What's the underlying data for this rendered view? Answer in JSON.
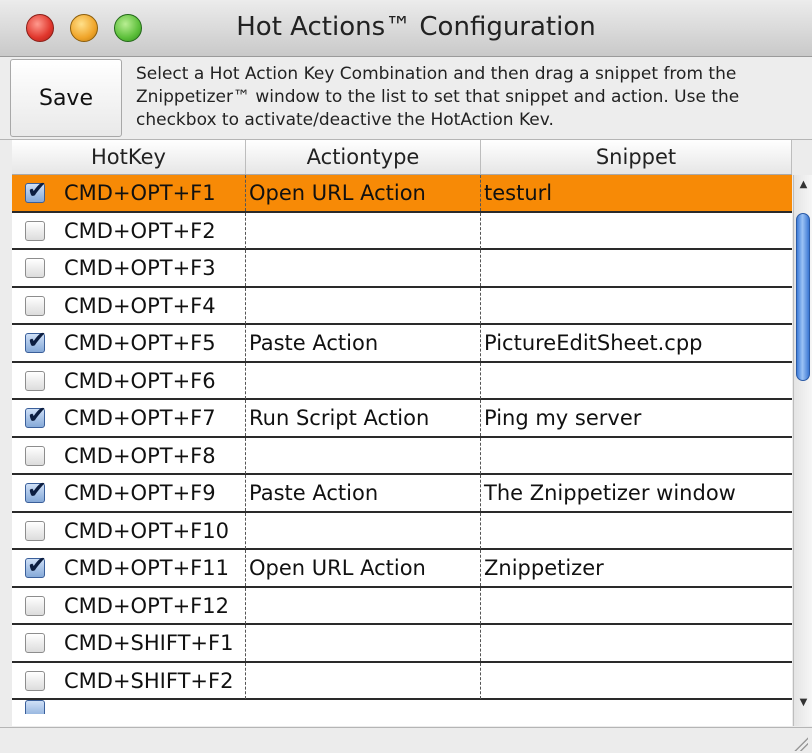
{
  "window": {
    "title": "Hot Actions™ Configuration"
  },
  "toolbar": {
    "save_label": "Save",
    "help_text": "Select a Hot Action Key Combination and then drag a snippet from the Znippetizer™ window to the list to set that snippet and action. Use the checkbox to activate/deactive the HotAction Kev."
  },
  "table": {
    "columns": [
      "HotKey",
      "Actiontype",
      "Snippet"
    ],
    "rows": [
      {
        "checked": true,
        "hotkey": "CMD+OPT+F1",
        "action": "Open URL Action",
        "snippet": "testurl",
        "selected": true
      },
      {
        "checked": false,
        "hotkey": "CMD+OPT+F2",
        "action": "",
        "snippet": ""
      },
      {
        "checked": false,
        "hotkey": "CMD+OPT+F3",
        "action": "",
        "snippet": ""
      },
      {
        "checked": false,
        "hotkey": "CMD+OPT+F4",
        "action": "",
        "snippet": ""
      },
      {
        "checked": true,
        "hotkey": "CMD+OPT+F5",
        "action": "Paste Action",
        "snippet": "PictureEditSheet.cpp"
      },
      {
        "checked": false,
        "hotkey": "CMD+OPT+F6",
        "action": "",
        "snippet": ""
      },
      {
        "checked": true,
        "hotkey": "CMD+OPT+F7",
        "action": "Run Script Action",
        "snippet": "Ping my server"
      },
      {
        "checked": false,
        "hotkey": "CMD+OPT+F8",
        "action": "",
        "snippet": ""
      },
      {
        "checked": true,
        "hotkey": "CMD+OPT+F9",
        "action": "Paste Action",
        "snippet": "The Znippetizer window"
      },
      {
        "checked": false,
        "hotkey": "CMD+OPT+F10",
        "action": "",
        "snippet": ""
      },
      {
        "checked": true,
        "hotkey": "CMD+OPT+F11",
        "action": "Open URL Action",
        "snippet": "Znippetizer"
      },
      {
        "checked": false,
        "hotkey": "CMD+OPT+F12",
        "action": "",
        "snippet": ""
      },
      {
        "checked": false,
        "hotkey": "CMD+SHIFT+F1",
        "action": "",
        "snippet": ""
      },
      {
        "checked": false,
        "hotkey": "CMD+SHIFT+F2",
        "action": "",
        "snippet": ""
      }
    ],
    "partial_row_checked": true
  },
  "colors": {
    "selection": "#f78a06",
    "scroll_thumb": "#3d7bd8"
  },
  "icons": {
    "close": "close-button-icon",
    "minimize": "minimize-button-icon",
    "zoom": "zoom-button-icon",
    "checkmark": "checkmark-icon",
    "scroll_up": "scroll-up-arrow-icon",
    "scroll_down": "scroll-down-arrow-icon",
    "resize": "resize-grip-icon"
  }
}
